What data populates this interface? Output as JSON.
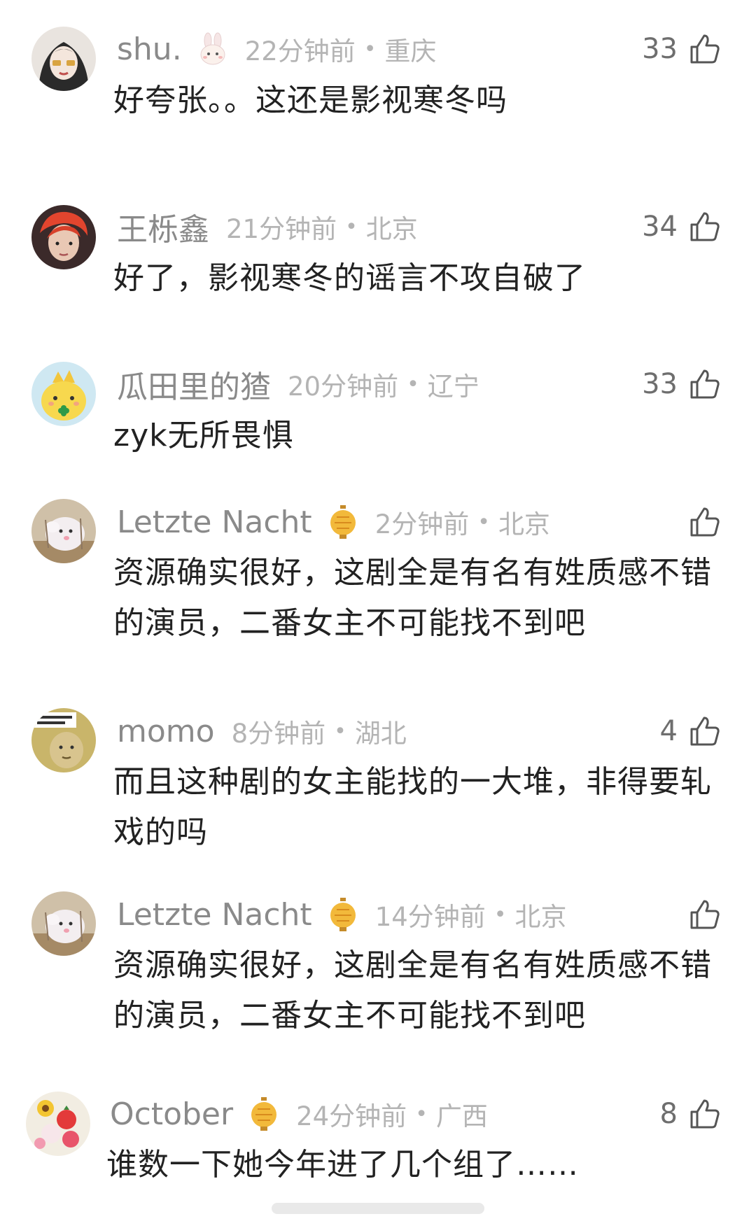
{
  "comments": [
    {
      "user": "shu.",
      "time": "22分钟前",
      "location": "重庆",
      "likes": "33",
      "text": "好夸张。。这还是影视寒冬吗",
      "badge": "rabbit-icon"
    },
    {
      "user": "王栎鑫",
      "time": "21分钟前",
      "location": "北京",
      "likes": "34",
      "text": "好了，影视寒冬的谣言不攻自破了"
    },
    {
      "user": "瓜田里的猹",
      "time": "20分钟前",
      "location": "辽宁",
      "likes": "33",
      "text": "zyk无所畏惧"
    },
    {
      "user": "Letzte Nacht",
      "time": "2分钟前",
      "location": "北京",
      "likes": "",
      "text": "资源确实很好，这剧全是有名有姓质感不错的演员，二番女主不可能找不到吧",
      "badge": "lantern-icon"
    },
    {
      "user": "momo",
      "time": "8分钟前",
      "location": "湖北",
      "likes": "4",
      "text": "而且这种剧的女主能找的一大堆，非得要轧戏的吗"
    },
    {
      "user": "Letzte Nacht",
      "time": "14分钟前",
      "location": "北京",
      "likes": "",
      "text": "资源确实很好，这剧全是有名有姓质感不错的演员，二番女主不可能找不到吧",
      "badge": "lantern-icon"
    },
    {
      "user": "October",
      "time": "24分钟前",
      "location": "广西",
      "likes": "8",
      "text": "谁数一下她今年进了几个组了……",
      "badge": "lantern-icon"
    }
  ],
  "separator": "•",
  "colors": {
    "username": "#8a8a8a",
    "meta": "#b4b4b4",
    "text": "#222222",
    "likes": "#6e6e6e"
  }
}
